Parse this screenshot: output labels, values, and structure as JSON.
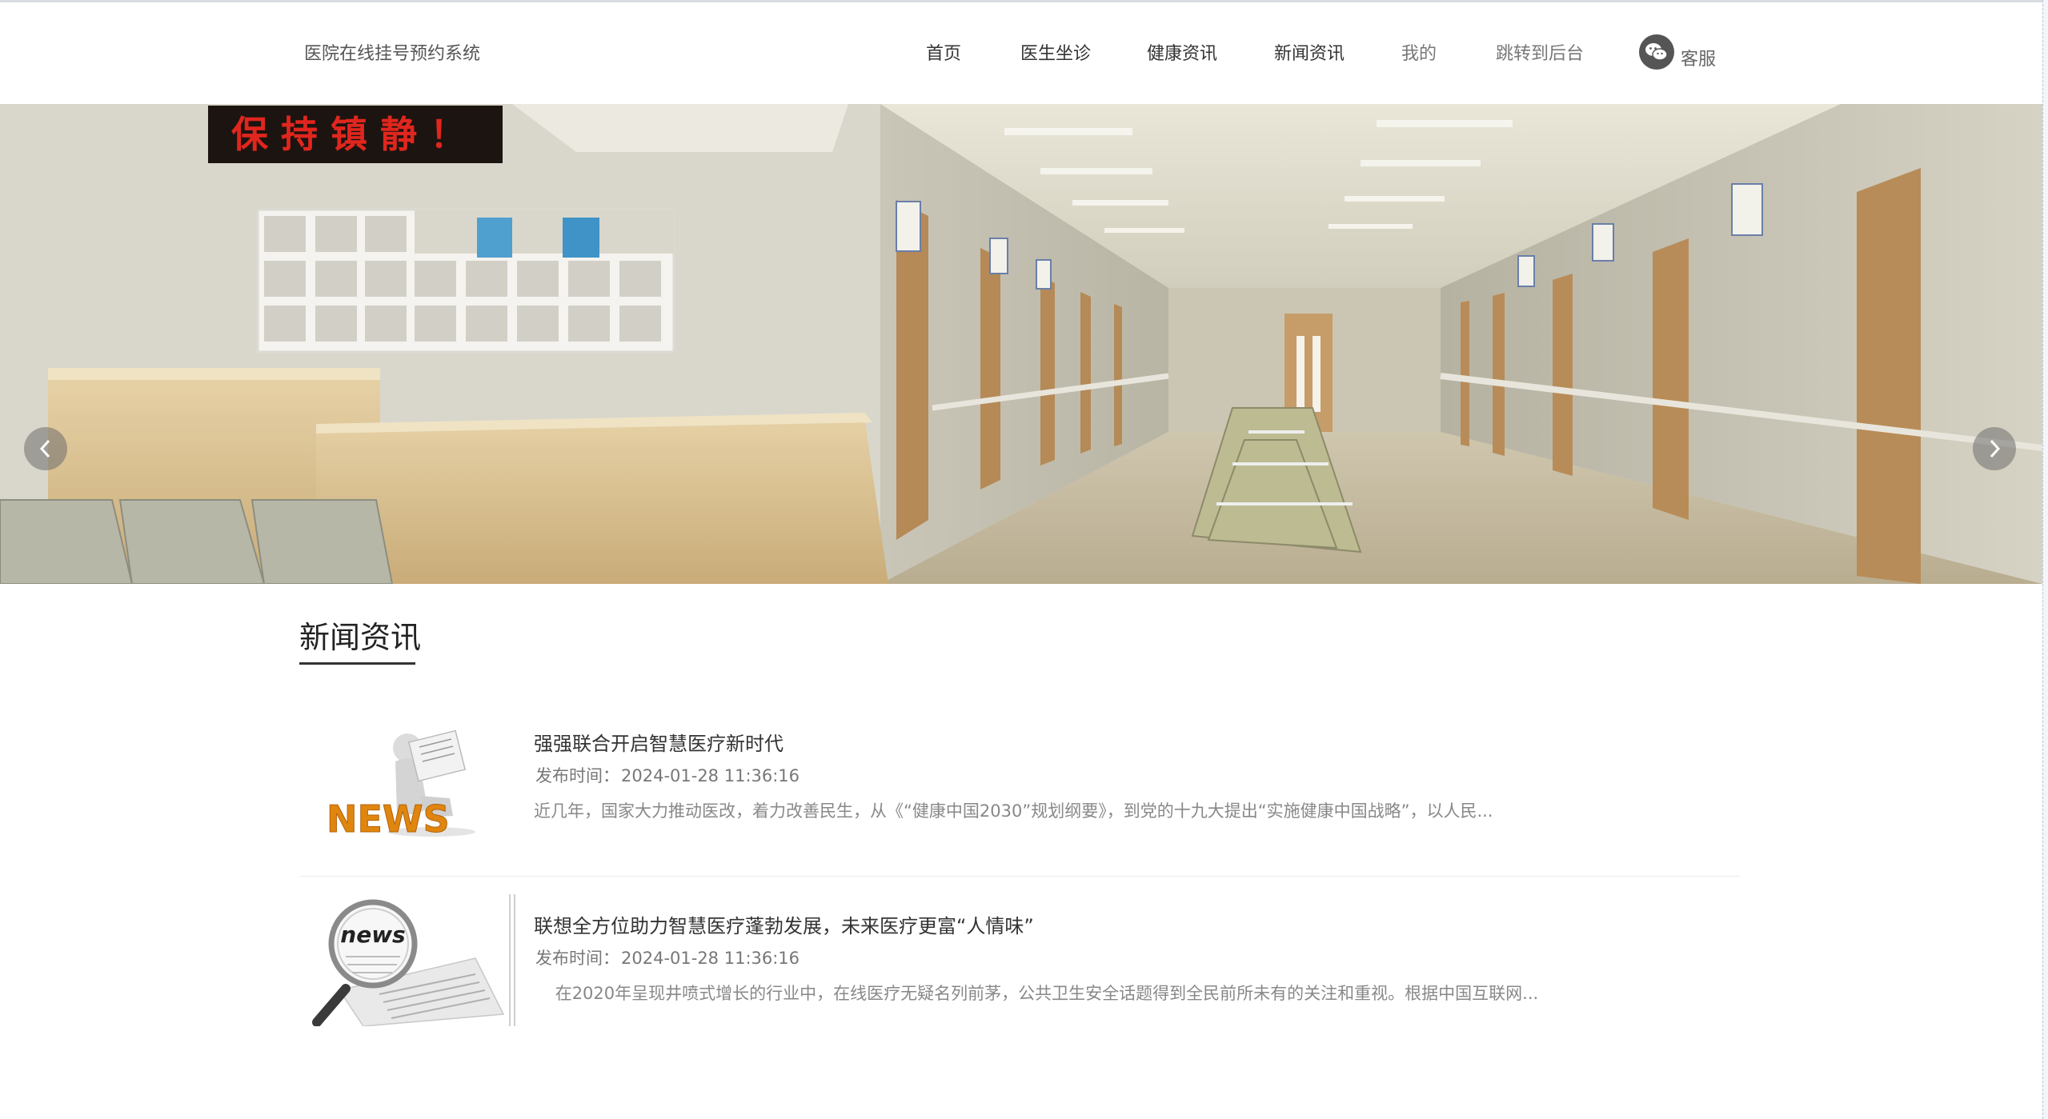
{
  "header": {
    "brand": "医院在线挂号预约系统",
    "nav": [
      {
        "label": "首页",
        "muted": false
      },
      {
        "label": "医生坐诊",
        "muted": false
      },
      {
        "label": "健康资讯",
        "muted": false
      },
      {
        "label": "新闻资讯",
        "muted": false
      },
      {
        "label": "我的",
        "muted": true
      },
      {
        "label": "跳转到后台",
        "muted": true
      }
    ],
    "customer_service": {
      "label": "客服",
      "icon": "wechat-icon"
    }
  },
  "banner": {
    "sign_text": "保持镇静！",
    "slide_count": 5,
    "active_slide": 1,
    "prev_icon": "chevron-left-icon",
    "next_icon": "chevron-right-icon"
  },
  "news": {
    "section_title": "新闻资讯",
    "date_label": "发布时间：",
    "items": [
      {
        "title": "强强联合开启智慧医疗新时代",
        "date": "2024-01-28 11:36:16",
        "summary": "近几年，国家大力推动医改，着力改善民生，从《“健康中国2030”规划纲要》，到党的十九大提出“实施健康中国战略”，以人民...",
        "thumb_text": "NEWS"
      },
      {
        "title": "联想全方位助力智慧医疗蓬勃发展，未来医疗更富“人情味”",
        "date": "2024-01-28 11:36:16",
        "summary": "    在2020年呈现井喷式增长的行业中，在线医疗无疑名列前茅，公共卫生安全话题得到全民前所未有的关注和重视。根据中国互联网...",
        "thumb_text": "news"
      }
    ]
  },
  "colors": {
    "text_primary": "#333333",
    "text_muted": "#777777",
    "underline": "#333333",
    "sign_red": "#e0261e"
  }
}
